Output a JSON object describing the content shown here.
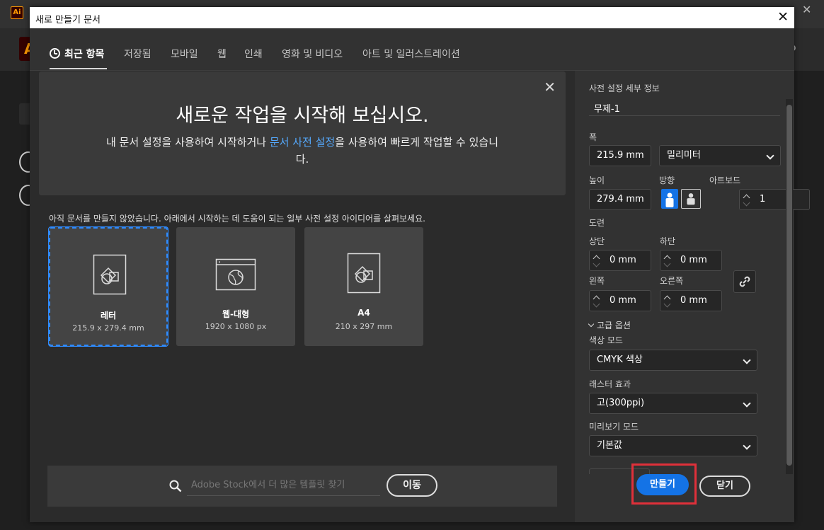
{
  "app": {
    "logo_small": "Ai",
    "logo_big": "A"
  },
  "dialog": {
    "title": "새로 만들기 문서",
    "tabs": [
      {
        "label": "최근 항목",
        "icon": "clock-icon"
      },
      {
        "label": "저장됨"
      },
      {
        "label": "모바일"
      },
      {
        "label": "웹"
      },
      {
        "label": "인쇄"
      },
      {
        "label": "영화 및 비디오"
      },
      {
        "label": "아트 및 일러스트레이션"
      }
    ],
    "hero": {
      "title": "새로운 작업을 시작해 보십시오.",
      "desc_before": "내 문서 설정을 사용하여 시작하거나 ",
      "desc_link": "문서 사전 설정",
      "desc_after": "을 사용하여 빠르게 작업할 수 있습니다."
    },
    "hint": "아직 문서를 만들지 않았습니다. 아래에서 시작하는 데 도움이 되는 일부 사전 설정 아이디어를 살펴보세요.",
    "presets": [
      {
        "name": "레터",
        "size": "215.9 x 279.4 mm",
        "icon": "document-icon"
      },
      {
        "name": "웹-대형",
        "size": "1920 x 1080 px",
        "icon": "web-icon"
      },
      {
        "name": "A4",
        "size": "210 x 297 mm",
        "icon": "document-icon"
      }
    ],
    "stock": {
      "placeholder": "Adobe Stock에서 더 많은 템플릿 찾기",
      "go_label": "이동"
    },
    "details": {
      "section_title": "사전 설정 세부 정보",
      "name": "무제-1",
      "width_label": "폭",
      "width_value": "215.9 mm",
      "unit_value": "밀리미터",
      "height_label": "높이",
      "height_value": "279.4 mm",
      "orientation_label": "방향",
      "artboard_label": "아트보드",
      "artboard_value": "1",
      "bleed_label": "도련",
      "top_label": "상단",
      "top_value": "0 mm",
      "bottom_label": "하단",
      "bottom_value": "0 mm",
      "left_label": "왼쪽",
      "left_value": "0 mm",
      "right_label": "오른쪽",
      "right_value": "0 mm",
      "advanced_label": "고급 옵션",
      "color_mode_label": "색상 모드",
      "color_mode_value": "CMYK 색상",
      "raster_label": "래스터 효과",
      "raster_value": "고(300ppi)",
      "preview_label": "미리보기 모드",
      "preview_value": "기본값"
    },
    "buttons": {
      "create": "만들기",
      "close": "닫기"
    }
  },
  "colors": {
    "accent": "#1473e6",
    "link": "#55aaff",
    "highlight": "#e0303a",
    "selection": "#2f8bff"
  }
}
